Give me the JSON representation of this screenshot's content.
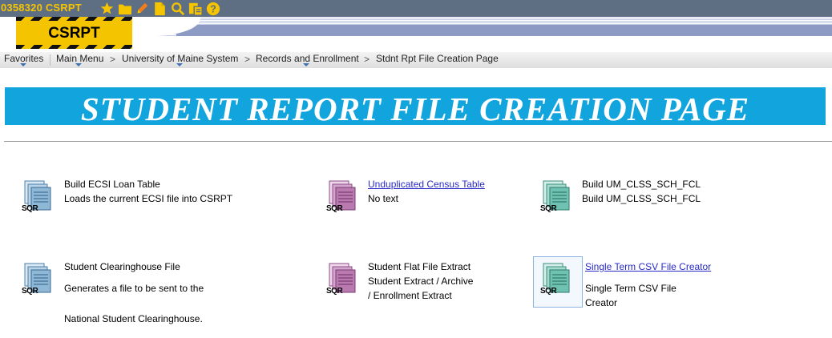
{
  "header": {
    "session_label": "0358320 CSRPT",
    "environment": "CSRPT",
    "icons": [
      "star-icon",
      "folder-icon",
      "pencil-icon",
      "document-icon",
      "search-icon",
      "report-icon",
      "help-icon"
    ]
  },
  "nav": {
    "favorites": "Favorites",
    "main_menu": "Main Menu",
    "breadcrumb": [
      "University of Maine System",
      "Records and Enrollment",
      "Stdnt Rpt File Creation Page"
    ],
    "separator": ">"
  },
  "page": {
    "title": "STUDENT REPORT FILE CREATION PAGE"
  },
  "items": [
    {
      "title": "Build ECSI Loan Table",
      "desc": [
        "Loads the current ECSI file into CSRPT"
      ],
      "is_link": false
    },
    {
      "title": "Unduplicated Census Table",
      "desc": [
        "No text"
      ],
      "is_link": true
    },
    {
      "title": "Build UM_CLSS_SCH_FCL",
      "desc": [
        "Build UM_CLSS_SCH_FCL"
      ],
      "is_link": false
    },
    {
      "title": "Student Clearinghouse File",
      "desc": [
        "Generates a file to be sent to the",
        "National Student Clearinghouse."
      ],
      "is_link": false
    },
    {
      "title": "Student Flat File Extract",
      "desc": [
        "Student Extract / Archive",
        "/ Enrollment Extract"
      ],
      "is_link": false
    },
    {
      "title": "Single Term CSV File Creator",
      "desc": [
        "Single Term CSV File",
        "Creator"
      ],
      "is_link": true
    }
  ],
  "icon_label": "SQR",
  "colors": {
    "topbar": "#5e6e83",
    "accent_yellow": "#f5c400",
    "title_band": "#12a4dc",
    "link": "#2a2ac8",
    "icon_blue": "#6f9fc4",
    "icon_purple": "#a76aa0",
    "icon_teal": "#4fae9c"
  }
}
